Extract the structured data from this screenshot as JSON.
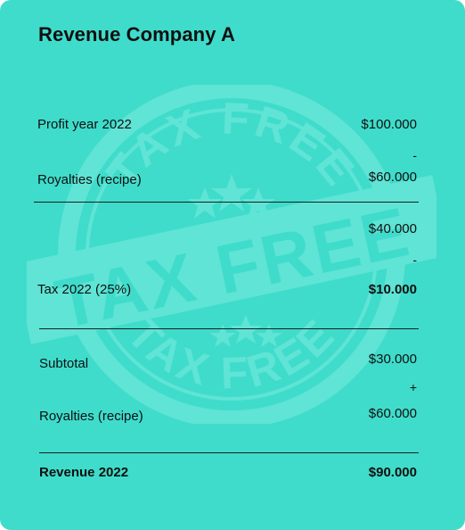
{
  "card": {
    "title": "Revenue Company A",
    "watermark_text": "TAX FREE",
    "colors": {
      "background": "#3fdccb",
      "stamp": "#5fe4d6",
      "text": "#101010",
      "divider": "#1e1e1e"
    }
  },
  "block1": {
    "row1": {
      "label": "Profit year 2022",
      "value": "$100.000"
    },
    "operator": "-",
    "row2": {
      "label": "Royalties (recipe)",
      "value": "$60.000"
    }
  },
  "block2": {
    "intermediate": "$40.000",
    "operator": "-",
    "tax": {
      "label": "Tax 2022 (25%)",
      "value": "$10.000"
    }
  },
  "block3": {
    "row1": {
      "label": "Subtotal",
      "value": "$30.000"
    },
    "operator": "+",
    "row2": {
      "label": "Royalties (recipe)",
      "value": "$60.000"
    }
  },
  "total": {
    "label": "Revenue 2022",
    "value": "$90.000"
  }
}
